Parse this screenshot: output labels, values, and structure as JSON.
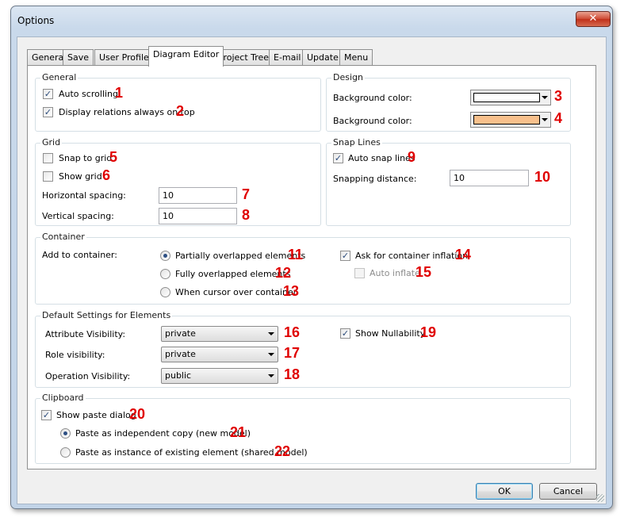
{
  "window": {
    "title": "Options",
    "close_glyph": "✕"
  },
  "tabs": [
    "General",
    "Save",
    "User Profile",
    "Diagram Editor",
    "Project Tree",
    "E-mail",
    "Update",
    "Menu"
  ],
  "active_tab": "Diagram Editor",
  "general": {
    "title": "General",
    "auto_scrolling": {
      "label": "Auto scrolling",
      "checked": true,
      "num": "1"
    },
    "display_relations": {
      "label": "Display relations always on top",
      "checked": true,
      "num": "2"
    }
  },
  "design": {
    "title": "Design",
    "bg1": {
      "label": "Background color:",
      "color": "#ffffff",
      "num": "3"
    },
    "bg2": {
      "label": "Background color:",
      "color": "#f8c08c",
      "num": "4"
    }
  },
  "grid": {
    "title": "Grid",
    "snap": {
      "label": "Snap to grid",
      "checked": false,
      "num": "5"
    },
    "show": {
      "label": "Show grid",
      "checked": false,
      "num": "6"
    },
    "hspacing": {
      "label": "Horizontal spacing:",
      "value": "10",
      "num": "7"
    },
    "vspacing": {
      "label": "Vertical spacing:",
      "value": "10",
      "num": "8"
    }
  },
  "snaplines": {
    "title": "Snap Lines",
    "auto": {
      "label": "Auto snap lines",
      "checked": true,
      "num": "9"
    },
    "distance": {
      "label": "Snapping distance:",
      "value": "10",
      "num": "10"
    }
  },
  "container": {
    "title": "Container",
    "add_label": "Add to container:",
    "partial": {
      "label": "Partially overlapped elements",
      "num": "11"
    },
    "full": {
      "label": "Fully overlapped elements",
      "num": "12"
    },
    "cursor": {
      "label": "When cursor over container",
      "num": "13"
    },
    "selected": "partial",
    "ask": {
      "label": "Ask for container inflation",
      "checked": true,
      "num": "14"
    },
    "auto_inflate": {
      "label": "Auto inflate",
      "checked": false,
      "enabled": false,
      "num": "15"
    }
  },
  "defaults": {
    "title": "Default Settings for Elements",
    "attr": {
      "label": "Attribute Visibility:",
      "value": "private",
      "num": "16"
    },
    "role": {
      "label": "Role visibility:",
      "value": "private",
      "num": "17"
    },
    "oper": {
      "label": "Operation Visibility:",
      "value": "public",
      "num": "18"
    },
    "nullability": {
      "label": "Show Nullability",
      "checked": true,
      "num": "19"
    }
  },
  "clipboard": {
    "title": "Clipboard",
    "show_paste": {
      "label": "Show paste dialog",
      "checked": true,
      "num": "20"
    },
    "copy": {
      "label": "Paste as independent copy (new model)",
      "num": "21"
    },
    "instance": {
      "label": "Paste as instance of existing element (shared model)",
      "num": "22"
    },
    "selected": "copy"
  },
  "buttons": {
    "ok": "OK",
    "cancel": "Cancel"
  },
  "check_glyph": "✓"
}
